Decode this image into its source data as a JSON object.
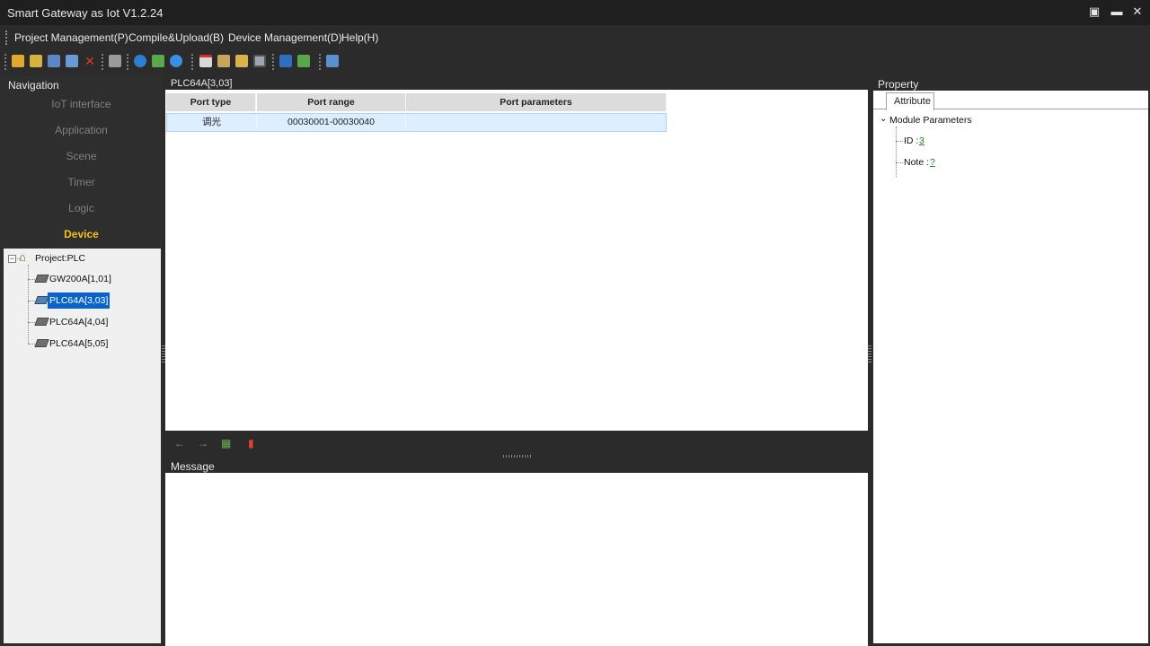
{
  "window": {
    "title": "Smart Gateway as Iot V1.2.24",
    "restore_glyph": "▣",
    "minimize_glyph": "▬",
    "close_glyph": "✕"
  },
  "menu": {
    "items": [
      {
        "label": "Project Management(P)"
      },
      {
        "label": "Compile&Upload(B)"
      },
      {
        "label": "Device Management(D)"
      },
      {
        "label": "Help(H)"
      }
    ]
  },
  "toolbar": {
    "icons": [
      "open-folder-icon",
      "open-project-icon",
      "save-icon",
      "save-as-icon",
      "close-project-icon",
      "erase-icon",
      "run-icon",
      "basket-icon",
      "globe-icon",
      "calendar-icon",
      "calculator-icon",
      "chart-icon",
      "monitor-icon",
      "upload-icon",
      "download-icon",
      "settings-brush-icon"
    ]
  },
  "navigation": {
    "header": "Navigation",
    "items": [
      {
        "label": "IoT interface",
        "active": false
      },
      {
        "label": "Application",
        "active": false
      },
      {
        "label": "Scene",
        "active": false
      },
      {
        "label": "Timer",
        "active": false
      },
      {
        "label": "Logic",
        "active": false
      },
      {
        "label": "Device",
        "active": true
      }
    ],
    "tree": {
      "root": {
        "label": "Project:PLC",
        "expander": "−"
      },
      "children": [
        {
          "label": "GW200A[1,01]",
          "selected": false
        },
        {
          "label": "PLC64A[3,03]",
          "selected": true
        },
        {
          "label": "PLC64A[4,04]",
          "selected": false
        },
        {
          "label": "PLC64A[5,05]",
          "selected": false
        }
      ]
    }
  },
  "center": {
    "header": "PLC64A[3,03]",
    "columns": [
      "Port type",
      "Port range",
      "Port parameters"
    ],
    "rows": [
      {
        "port_type": "调光",
        "port_range": "00030001-00030040",
        "port_parameters": ""
      }
    ]
  },
  "footer_icons": {
    "back": "←",
    "forward": "→",
    "basket": "▦",
    "pdf": "▮"
  },
  "message": {
    "header": "Message"
  },
  "property": {
    "header": "Property",
    "tab": "Attribute",
    "group": "Module Parameters",
    "fields": [
      {
        "label": "ID :",
        "value": "3"
      },
      {
        "label": "Note :",
        "value": "?"
      }
    ]
  },
  "colors": {
    "active_nav": "#f3c11a",
    "selection": "#0a63c9",
    "row_highlight": "#dceeff"
  }
}
